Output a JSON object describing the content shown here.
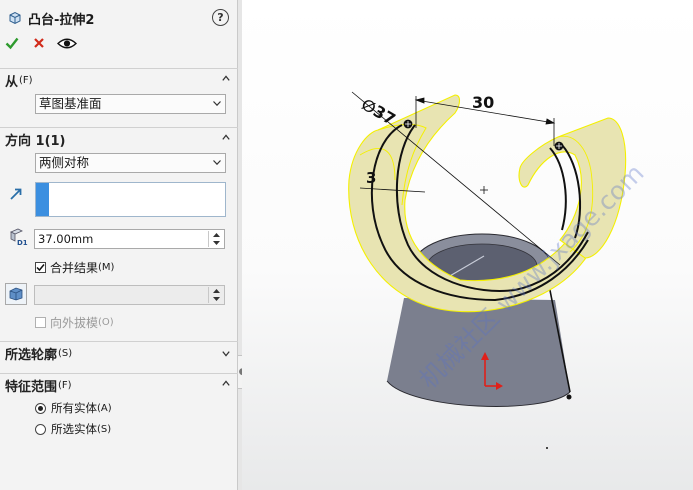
{
  "panel": {
    "title": "凸台-拉伸2",
    "help_glyph": "?",
    "sections": {
      "from": {
        "label": "从",
        "suffix": "(F)",
        "start_condition": "草图基准面"
      },
      "direction1": {
        "label": "方向 1(1)",
        "end_condition": "两侧对称",
        "depth_value": "37.00mm",
        "merge_result": {
          "label": "合并结果",
          "suffix": "(M)",
          "checked": true
        },
        "draft_outward": {
          "label": "向外拔模",
          "suffix": "(O)",
          "checked": false
        }
      },
      "selected_contours": {
        "label": "所选轮廓",
        "suffix": "(S)"
      },
      "feature_scope": {
        "label": "特征范围",
        "suffix": "(F)",
        "options": [
          {
            "label": "所有实体",
            "suffix": "(A)",
            "selected": true
          },
          {
            "label": "所选实体",
            "suffix": "(S)",
            "selected": false
          }
        ]
      }
    }
  },
  "viewport": {
    "dim_diameter": "∅37",
    "dim_length": "30",
    "dim_thickness": "3",
    "watermark": "机械社区 www.jxage.com"
  },
  "colors": {
    "accent_blue": "#3b8fe0",
    "ok_green": "#2e9a2e",
    "cancel_red": "#d12a1a",
    "preview_yellow": "#e8e4b2",
    "base_gray": "#7d8190"
  }
}
